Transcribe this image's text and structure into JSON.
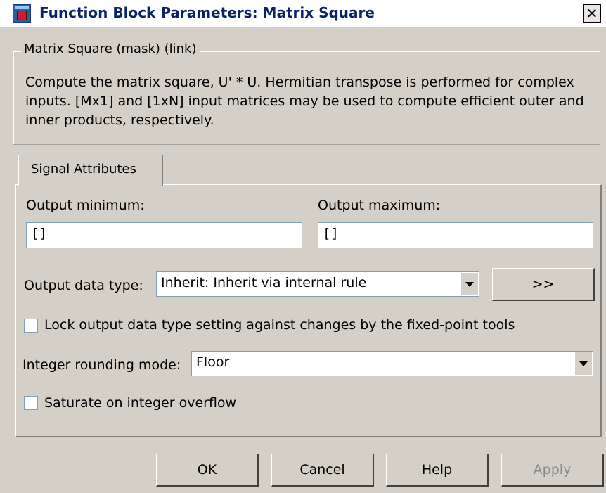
{
  "window": {
    "title": "Function Block Parameters: Matrix Square",
    "close_glyph": "✕"
  },
  "mask": {
    "legend": "Matrix Square (mask) (link)",
    "description": "Compute the matrix square, U' * U.  Hermitian transpose is performed for complex inputs.  [Mx1] and [1xN] input matrices may be used to compute efficient outer and inner products, respectively."
  },
  "tabs": [
    {
      "label": "Signal Attributes",
      "selected": true
    }
  ],
  "signal_attributes": {
    "output_minimum_label": "Output minimum:",
    "output_minimum_value": "[]",
    "output_maximum_label": "Output maximum:",
    "output_maximum_value": "[]",
    "output_data_type_label": "Output data type:",
    "output_data_type_value": "Inherit: Inherit via internal rule",
    "data_type_assistant_label": ">>",
    "lock_label": "Lock output data type setting against changes by the fixed-point tools",
    "lock_checked": false,
    "rounding_label": "Integer rounding mode:",
    "rounding_value": "Floor",
    "saturate_label": "Saturate on integer overflow",
    "saturate_checked": false
  },
  "buttons": {
    "ok": "OK",
    "cancel": "Cancel",
    "help": "Help",
    "apply": "Apply",
    "apply_disabled": true
  },
  "icons": {
    "window": "simulink-block-icon",
    "dropdown": "chevron-down-icon"
  }
}
